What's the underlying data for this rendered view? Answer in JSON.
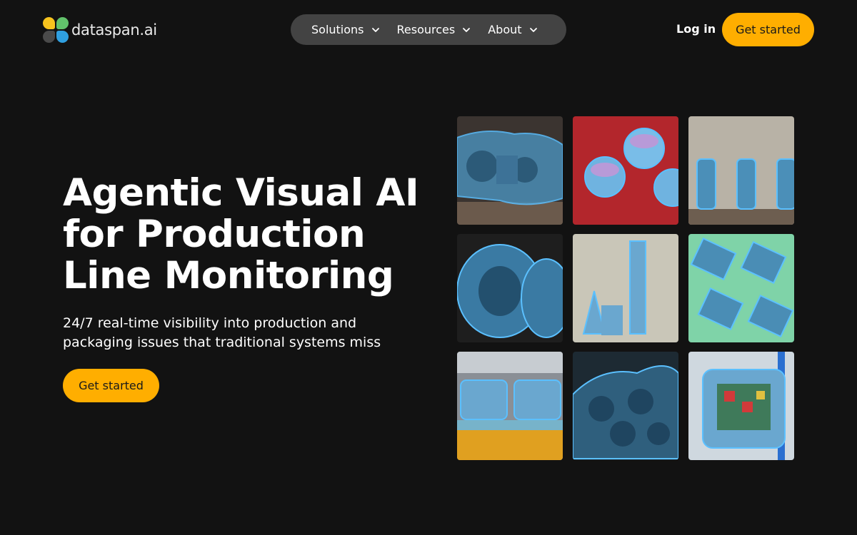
{
  "brand": {
    "name": "dataspan.ai"
  },
  "nav": {
    "items": [
      {
        "label": "Solutions",
        "icon": "chevron-down-icon"
      },
      {
        "label": "Resources",
        "icon": "chevron-down-icon"
      },
      {
        "label": "About",
        "icon": "chevron-down-icon"
      }
    ],
    "login_label": "Log in",
    "cta_label": "Get started"
  },
  "hero": {
    "title_lines": [
      "Agentic Visual AI",
      "for Production",
      "Line Monitoring"
    ],
    "subtitle_lines": [
      "24/7 real-time visibility into production and",
      "packaging issues that traditional systems miss"
    ],
    "cta_label": "Get started"
  },
  "gallery": {
    "tiles": [
      {
        "subject": "railcar-bogie"
      },
      {
        "subject": "circuit-capacitors"
      },
      {
        "subject": "molded-parts-row"
      },
      {
        "subject": "tire-tread"
      },
      {
        "subject": "gear-shafts"
      },
      {
        "subject": "pcb-components"
      },
      {
        "subject": "car-assembly-line"
      },
      {
        "subject": "gear-pile"
      },
      {
        "subject": "circuit-board-robot"
      }
    ]
  },
  "colors": {
    "background": "#121212",
    "accent": "#ffae00",
    "nav_pill": "#434343",
    "segmentation_overlay": "#4fb3ff"
  }
}
